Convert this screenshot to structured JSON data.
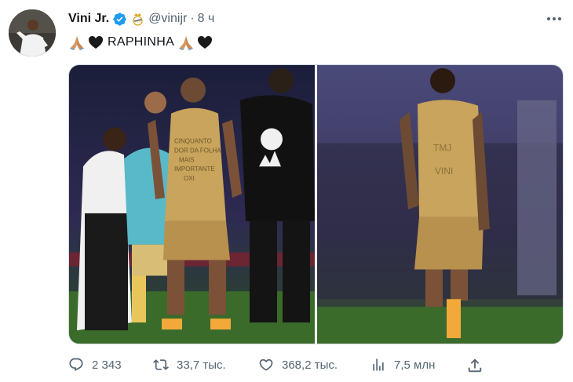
{
  "post": {
    "author_name": "Vini Jr.",
    "handle": "@vinijr",
    "separator": "·",
    "time": "8 ч",
    "text": "RAPHINHA",
    "emojis": [
      "folded-hands",
      "black-heart"
    ]
  },
  "icons": {
    "verified": "verified-badge-icon",
    "club_crest": "real-madrid-crest-icon",
    "more": "more-icon"
  },
  "stats": {
    "replies": "2 343",
    "reposts": "33,7 тыс.",
    "likes": "368,2 тыс.",
    "views": "7,5 млн"
  },
  "media": {
    "count": 2,
    "left_shirt_text": [
      "CINQUANTO",
      "DOR DA FOLHA",
      "MAIS",
      "IMPORTANTE",
      "OXI"
    ],
    "right_shirt_text": [
      "TMJ",
      "VINI"
    ]
  },
  "colors": {
    "text_primary": "#0f1419",
    "text_secondary": "#536471",
    "verified_blue": "#1d9bf0",
    "kit_gold": "#c9a45c",
    "pitch_green": "#3a6b2a"
  }
}
